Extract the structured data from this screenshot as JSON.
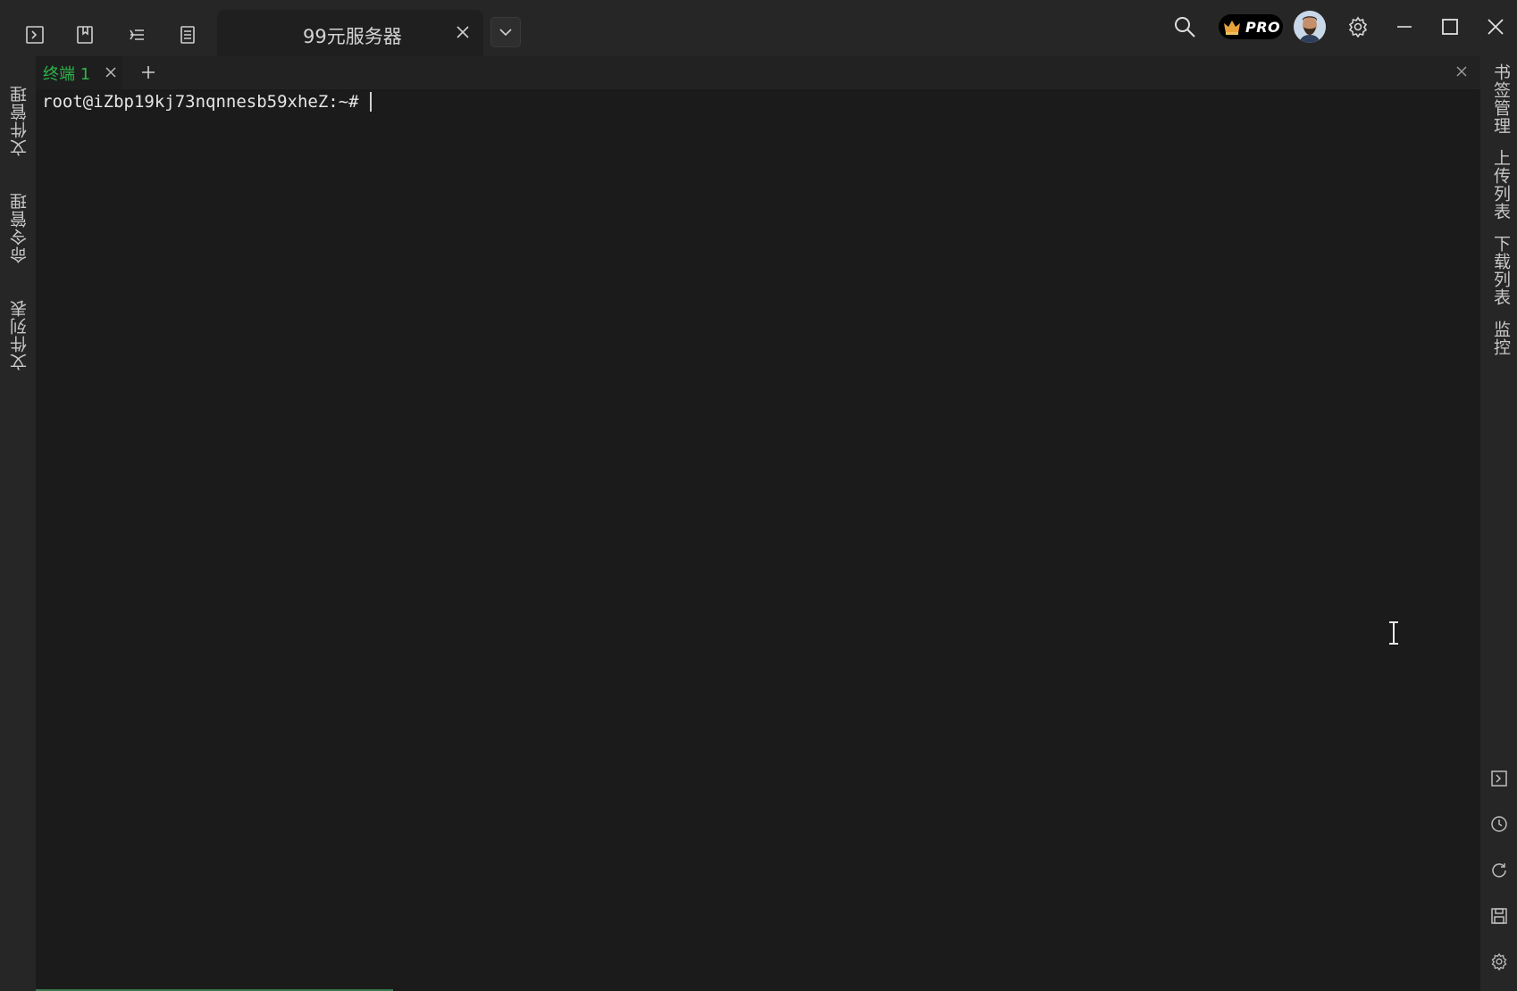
{
  "titlebar": {
    "session_tab_label": "99元服务器",
    "pro_label": "PRO"
  },
  "terminal_tabs": {
    "active_tab_label": "终端 1"
  },
  "terminal": {
    "prompt": "root@iZbp19kj73nqnnesb59xheZ:~#"
  },
  "left_sidebar": {
    "items": [
      "文件管理",
      "命令管理",
      "文件列表"
    ]
  },
  "right_sidebar": {
    "items": [
      "书签管理",
      "上传列表",
      "下载列表",
      "监控"
    ]
  },
  "colors": {
    "accent_green": "#2fb34b",
    "background": "#1b1b1b",
    "chrome": "#262626"
  }
}
